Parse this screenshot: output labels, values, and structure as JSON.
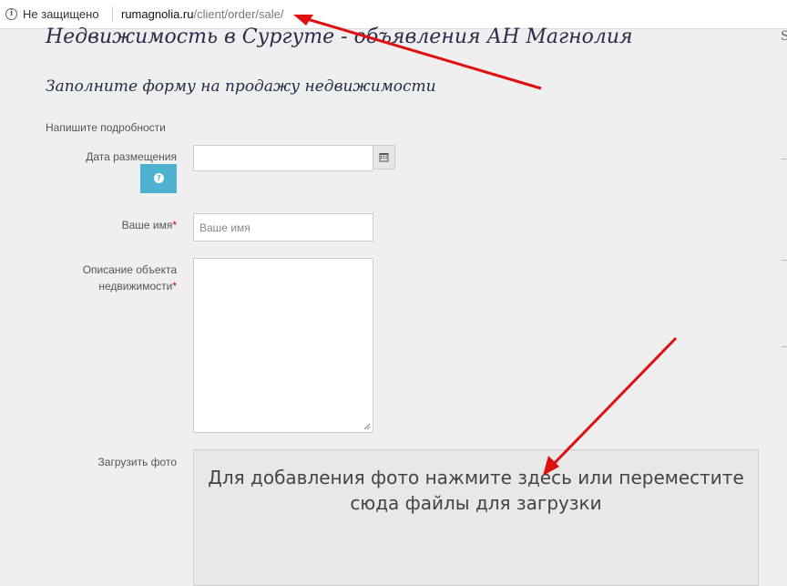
{
  "browser": {
    "security_label": "Не защищено",
    "url_host": "rumagnolia.ru",
    "url_path": "/client/order/sale/"
  },
  "page": {
    "site_title": "Недвижимость в Сургуте - объявления АН Магнолия",
    "right_edge_char": "S",
    "form_title": "Заполните форму на продажу недвижимости",
    "section_label": "Напишите подробности"
  },
  "form": {
    "date_label": "Дата размещения",
    "date_value": "",
    "name_label": "Ваше имя",
    "name_placeholder": "Ваше имя",
    "required_mark": "*",
    "description_label_line1": "Описание объекта",
    "description_label_line2": "недвижимости",
    "upload_label": "Загрузить фото",
    "upload_text": "Для добавления фото нажмите здесь или переместите сюда файлы для загрузки"
  },
  "colors": {
    "accent": "#4fb1d0",
    "required": "#c00000",
    "annotation_arrow": "#e01010"
  },
  "icons": [
    "info-icon",
    "calendar-icon",
    "question-icon"
  ]
}
